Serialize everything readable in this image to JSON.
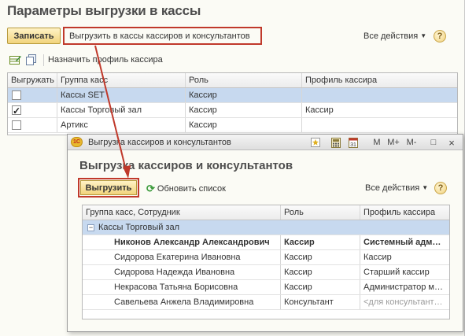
{
  "main": {
    "title": "Параметры выгрузки в кассы",
    "save_label": "Записать",
    "export_label": "Выгрузить в кассы кассиров и консультантов",
    "all_actions_label": "Все действия",
    "help_label": "?",
    "assign_profile_label": "Назначить профиль кассира",
    "columns": [
      "Выгружать",
      "Группа касс",
      "Роль",
      "Профиль кассира"
    ],
    "rows": [
      {
        "checked": false,
        "group": "Кассы SET",
        "role": "Кассир",
        "profile": ""
      },
      {
        "checked": true,
        "group": "Кассы Торговый зал",
        "role": "Кассир",
        "profile": "Кассир"
      },
      {
        "checked": false,
        "group": "Артикс",
        "role": "Кассир",
        "profile": ""
      }
    ]
  },
  "dialog": {
    "caption": "Выгрузка кассиров и консультантов",
    "caption_buttons": [
      "M",
      "M+",
      "M-",
      "□",
      "×"
    ],
    "title": "Выгрузка кассиров и консультантов",
    "upload_label": "Выгрузить",
    "refresh_label": "Обновить список",
    "all_actions_label": "Все действия",
    "help_label": "?",
    "columns": [
      "Группа касс, Сотрудник",
      "Роль",
      "Профиль кассира"
    ],
    "group_row": "Кассы Торговый зал",
    "rows": [
      {
        "name": "Никонов Александр Александрович",
        "role": "Кассир",
        "profile": "Системный администратор",
        "bold": true,
        "muted": false
      },
      {
        "name": "Сидорова Екатерина Ивановна",
        "role": "Кассир",
        "profile": "Кассир",
        "bold": false,
        "muted": false
      },
      {
        "name": "Сидорова Надежда Ивановна",
        "role": "Кассир",
        "profile": "Старший кассир",
        "bold": false,
        "muted": false
      },
      {
        "name": "Некрасова Татьяна Борисовна",
        "role": "Кассир",
        "profile": "Администратор магазина",
        "bold": false,
        "muted": false
      },
      {
        "name": "Савельева Анжела Владимировна",
        "role": "Консультант",
        "profile": "<для консультантов>",
        "bold": false,
        "muted": true
      }
    ]
  },
  "colors": {
    "accent_red": "#c0392b",
    "button_yellow": "#f1d37c",
    "selection_blue": "#c7d9ef"
  },
  "icons": [
    "grid-edit-icon",
    "copy-icon",
    "refresh-icon",
    "help-icon",
    "1c-logo-icon",
    "star-icon",
    "calculator-icon",
    "calendar-icon",
    "chevron-down-icon",
    "collapse-icon"
  ]
}
